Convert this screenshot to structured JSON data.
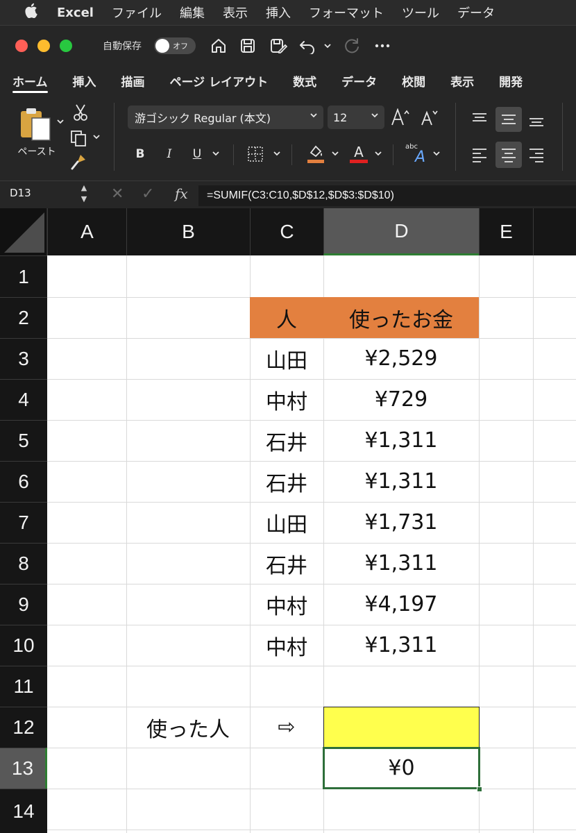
{
  "menubar": {
    "app": "Excel",
    "items": [
      "ファイル",
      "編集",
      "表示",
      "挿入",
      "フォーマット",
      "ツール",
      "データ"
    ]
  },
  "titlebar": {
    "autosave_label": "自動保存",
    "autosave_state": "オフ",
    "icons": [
      "home-icon",
      "save-icon",
      "save-as-icon",
      "undo-icon",
      "redo-icon",
      "more-icon"
    ]
  },
  "ribbon_tabs": [
    "ホーム",
    "挿入",
    "描画",
    "ページ レイアウト",
    "数式",
    "データ",
    "校閲",
    "表示",
    "開発"
  ],
  "ribbon_active_tab": "ホーム",
  "ribbon": {
    "paste_label": "ペースト",
    "font_name": "游ゴシック Regular (本文)",
    "font_size": "12",
    "bold": "B",
    "italic": "I",
    "underline": "U",
    "font_color_letter": "A",
    "fill_color": "#e3803f",
    "font_color": "#e02020",
    "abc_label": "abc"
  },
  "formula_bar": {
    "name_box": "D13",
    "fx": "fx",
    "formula": "=SUMIF(C3:C10,$D$12,$D$3:$D$10)"
  },
  "sheet": {
    "columns": [
      "A",
      "B",
      "C",
      "D",
      "E"
    ],
    "selected_column": "D",
    "rows": [
      "1",
      "2",
      "3",
      "4",
      "5",
      "6",
      "7",
      "8",
      "9",
      "10",
      "11",
      "12",
      "13",
      "14"
    ],
    "selected_row": "13",
    "header_fill_color": "#e3803f",
    "criteria_fill_color": "#ffff4d",
    "table": {
      "header_person": "人",
      "header_amount": "使ったお金",
      "records": [
        {
          "person": "山田",
          "amount": "¥2,529"
        },
        {
          "person": "中村",
          "amount": "¥729"
        },
        {
          "person": "石井",
          "amount": "¥1,311"
        },
        {
          "person": "石井",
          "amount": "¥1,311"
        },
        {
          "person": "山田",
          "amount": "¥1,731"
        },
        {
          "person": "石井",
          "amount": "¥1,311"
        },
        {
          "person": "中村",
          "amount": "¥4,197"
        },
        {
          "person": "中村",
          "amount": "¥1,311"
        }
      ]
    },
    "b12_label": "使った人",
    "c12_arrow": "⇨",
    "d12_value": "",
    "d13_result": "¥0"
  }
}
